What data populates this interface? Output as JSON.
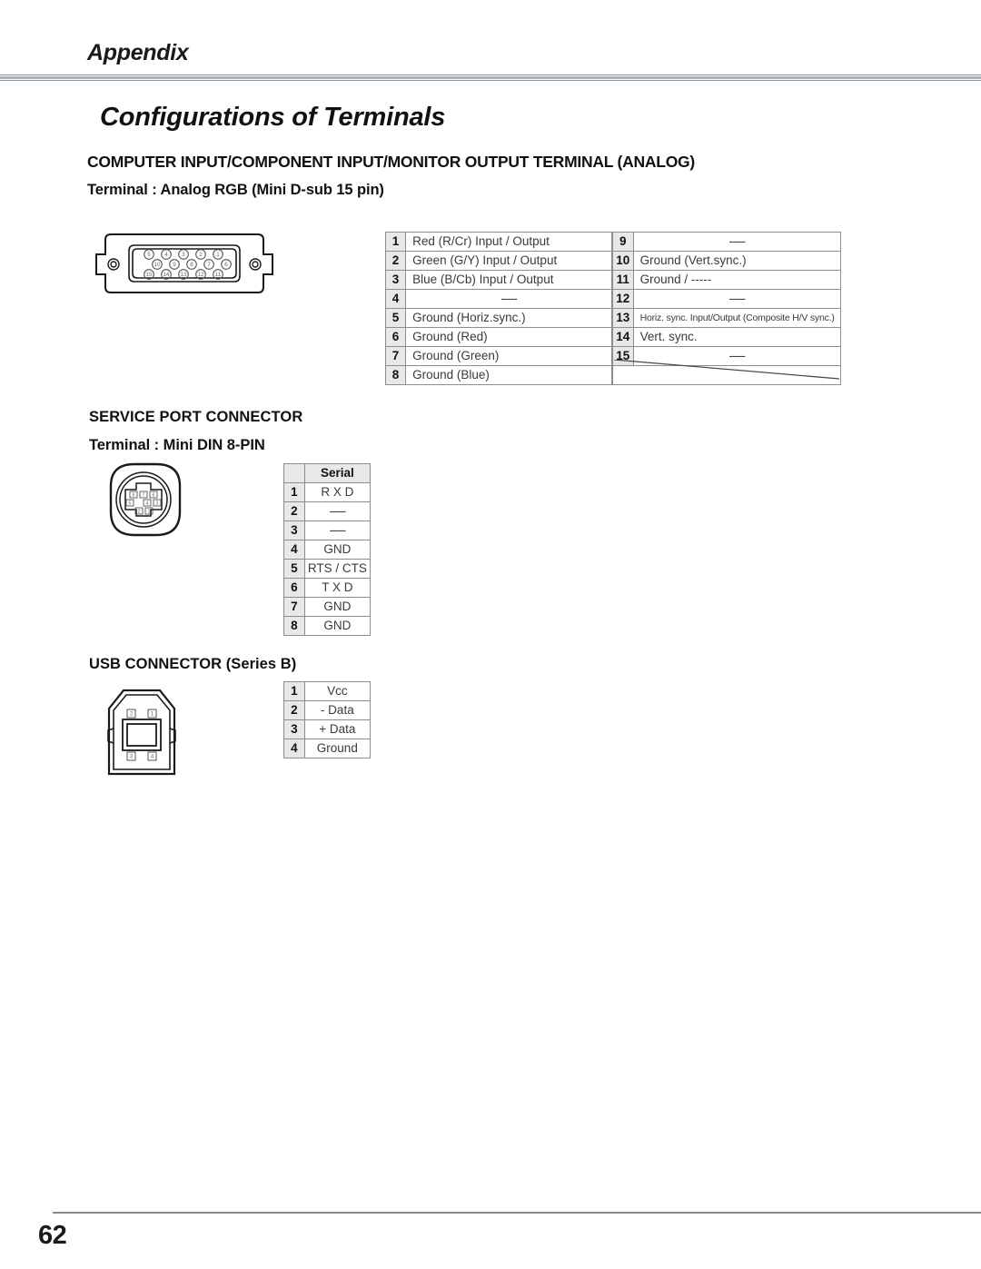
{
  "header": {
    "running_head": "Appendix"
  },
  "title": "Configurations of Terminals",
  "sections": {
    "analog": {
      "heading": "COMPUTER INPUT/COMPONENT INPUT/MONITOR OUTPUT TERMINAL (ANALOG)",
      "subheading": "Terminal : Analog RGB (Mini D-sub 15 pin)",
      "connector": {
        "type": "mini-d-sub-15-pin",
        "rows": [
          [
            "5",
            "4",
            "3",
            "2",
            "1"
          ],
          [
            "10",
            "9",
            "8",
            "7",
            "6"
          ],
          [
            "15",
            "14",
            "13",
            "12",
            "11"
          ]
        ]
      },
      "pins_left": [
        {
          "num": "1",
          "value": "Red (R/Cr) Input / Output",
          "align": "left"
        },
        {
          "num": "2",
          "value": "Green (G/Y) Input / Output",
          "align": "left"
        },
        {
          "num": "3",
          "value": "Blue (B/Cb) Input / Output",
          "align": "left"
        },
        {
          "num": "4",
          "value": "-----",
          "align": "center"
        },
        {
          "num": "5",
          "value": "Ground (Horiz.sync.)",
          "align": "left"
        },
        {
          "num": "6",
          "value": "Ground (Red)",
          "align": "left"
        },
        {
          "num": "7",
          "value": "Ground (Green)",
          "align": "left"
        },
        {
          "num": "8",
          "value": "Ground (Blue)",
          "align": "left"
        }
      ],
      "pins_right": [
        {
          "num": "9",
          "value": "-----",
          "align": "center"
        },
        {
          "num": "10",
          "value": "Ground (Vert.sync.)",
          "align": "left"
        },
        {
          "num": "11",
          "value": "Ground /  -----",
          "align": "left"
        },
        {
          "num": "12",
          "value": "-----",
          "align": "center"
        },
        {
          "num": "13",
          "value": "Horiz. sync. Input/Output (Composite H/V sync.)",
          "align": "tiny"
        },
        {
          "num": "14",
          "value": "Vert. sync.",
          "align": "left"
        },
        {
          "num": "15",
          "value": "-----",
          "align": "center"
        }
      ]
    },
    "service": {
      "heading": "SERVICE PORT CONNECTOR",
      "subheading": "Terminal : Mini DIN 8-PIN",
      "connector": {
        "type": "mini-din-8-pin",
        "rows": [
          [
            "8",
            "7",
            "6"
          ],
          [
            "5",
            "4",
            "3"
          ],
          [
            "2",
            "1"
          ]
        ]
      },
      "table_header": "Serial",
      "pins": [
        {
          "num": "1",
          "value": "R X D"
        },
        {
          "num": "2",
          "value": "-----"
        },
        {
          "num": "3",
          "value": "-----"
        },
        {
          "num": "4",
          "value": "GND"
        },
        {
          "num": "5",
          "value": "RTS / CTS"
        },
        {
          "num": "6",
          "value": "T X D"
        },
        {
          "num": "7",
          "value": "GND"
        },
        {
          "num": "8",
          "value": "GND"
        }
      ]
    },
    "usb": {
      "heading": "USB CONNECTOR (Series B)",
      "connector": {
        "type": "usb-series-b",
        "rows": [
          [
            "2",
            "1"
          ],
          [
            "3",
            "4"
          ]
        ]
      },
      "pins": [
        {
          "num": "1",
          "value": "Vcc"
        },
        {
          "num": "2",
          "value": "- Data"
        },
        {
          "num": "3",
          "value": "+ Data"
        },
        {
          "num": "4",
          "value": "Ground"
        }
      ]
    }
  },
  "footer": {
    "page_number": "62"
  },
  "colors": {
    "rule": "#8a9499",
    "cell_shade": "#e8e8e8",
    "border": "#8d8d8d",
    "text": "#1a1a1a"
  }
}
